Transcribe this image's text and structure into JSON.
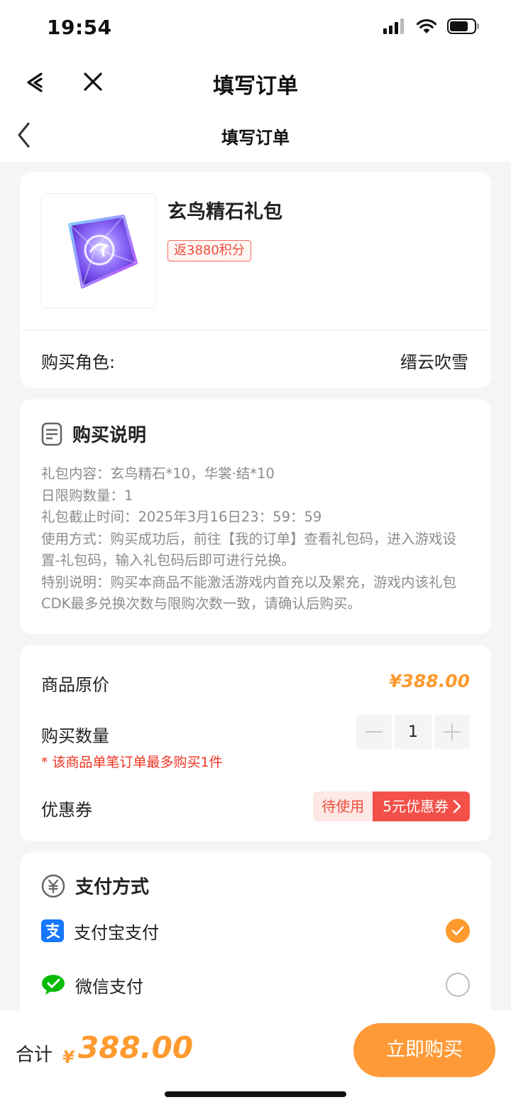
{
  "status_bar": {
    "time": "19:54"
  },
  "app_bar": {
    "title": "填写订单"
  },
  "page_header": {
    "title": "填写订单"
  },
  "product": {
    "name": "玄鸟精石礼包",
    "points_badge": "返3880积分",
    "role_label": "购买角色:",
    "role_value": "缙云吹雪"
  },
  "description": {
    "heading": "购买说明",
    "lines": [
      "礼包内容：玄鸟精石*10，华裳·结*10",
      "日限购数量：1",
      "礼包截止时间：2025年3月16日23：59：59",
      "使用方式：购买成功后，前往【我的订单】查看礼包码，进入游戏设置-礼包码，输入礼包码后即可进行兑换。",
      "特别说明：购买本商品不能激活游戏内首充以及累充，游戏内该礼包CDK最多兑换次数与限购次数一致，请确认后购买。"
    ]
  },
  "pricing": {
    "original_price_label": "商品原价",
    "original_price": "¥388.00",
    "quantity_label": "购买数量",
    "quantity": "1",
    "limit_note": "* 该商品单笔订单最多购买1件",
    "coupon_label": "优惠券",
    "coupon_status": "待使用",
    "coupon_value": "5元优惠券"
  },
  "payment": {
    "heading": "支付方式",
    "options": [
      {
        "label": "支付宝支付",
        "selected": true
      },
      {
        "label": "微信支付",
        "selected": false
      }
    ]
  },
  "footer": {
    "total_label": "合计",
    "currency": "¥",
    "total_amount": "388.00",
    "buy_label": "立即购买"
  },
  "colors": {
    "accent": "#ff9a2e",
    "alert": "#ee3322",
    "coupon": "#f4504a",
    "alipay": "#1677ff",
    "wechat": "#09bb07"
  },
  "icons": [
    "signal-icon",
    "wifi-icon",
    "battery-icon",
    "back-arrow-icon",
    "close-icon",
    "chevron-left-icon",
    "document-icon",
    "yuan-icon",
    "alipay-icon",
    "wechat-icon",
    "check-icon"
  ]
}
